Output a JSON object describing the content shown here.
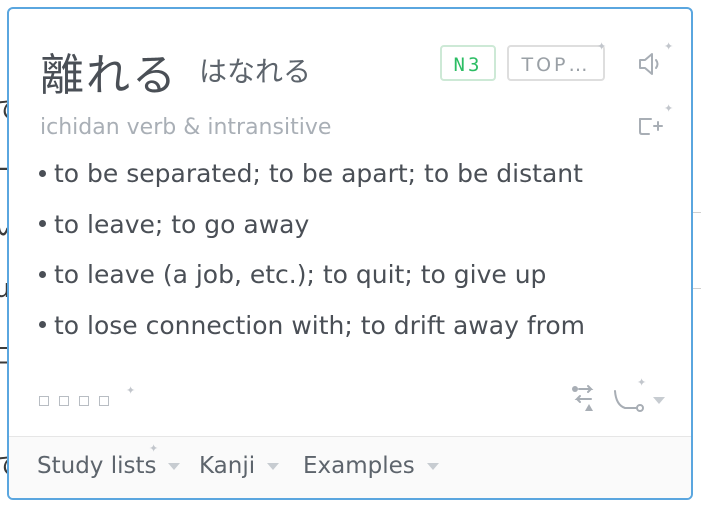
{
  "background": {
    "glyphs": [
      "「",
      "で",
      "ー",
      "い",
      "u",
      "ロ",
      "て"
    ]
  },
  "entry": {
    "headword": "離れる",
    "reading": "はなれる",
    "jlpt_badge": "N3",
    "frequency_badge": "TOP…",
    "part_of_speech": "ichidan verb & intransitive",
    "definitions": [
      "to be separated; to be apart; to be distant",
      "to leave; to go away",
      "to leave (a job, etc.); to quit; to give up",
      "to lose connection with; to drift away from"
    ]
  },
  "icons": {
    "audio": "speaker-icon",
    "add": "add-to-list-icon",
    "conjugate": "conjugation-icon",
    "path": "path-icon",
    "dropdown": "chevron-down-icon"
  },
  "footer": {
    "tabs": [
      {
        "label": "Study lists"
      },
      {
        "label": "Kanji"
      },
      {
        "label": "Examples"
      }
    ]
  },
  "colors": {
    "border": "#5aa6df",
    "text": "#4a4f56",
    "muted": "#a9afb6",
    "jlpt_green": "#2cbd64"
  }
}
